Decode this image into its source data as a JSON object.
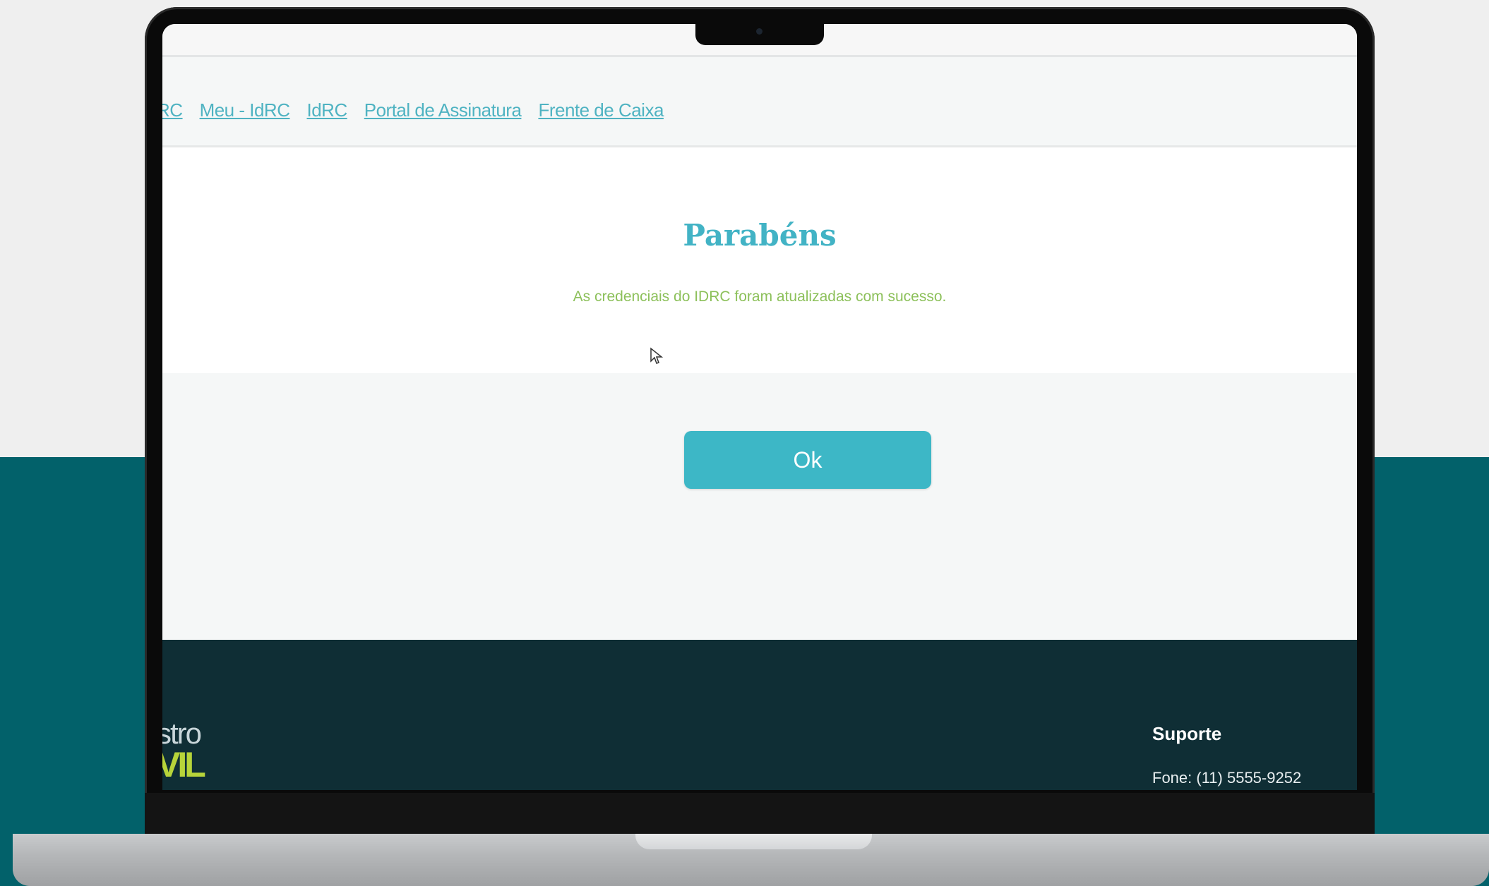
{
  "nav": {
    "links": [
      "RC",
      "Meu - IdRC",
      "IdRC",
      "Portal de Assinatura",
      "Frente de Caixa"
    ]
  },
  "dialog": {
    "title": "Parabéns",
    "message": "As credenciais do IDRC foram atualizadas com sucesso.",
    "ok_label": "Ok"
  },
  "footer": {
    "logo_top": "stro",
    "logo_bottom": "VIL",
    "support_title": "Suporte",
    "support_phone": "Fone: (11) 5555-9252"
  },
  "colors": {
    "accent": "#3db7c6",
    "title": "#42b3c5",
    "success": "#8cc05a",
    "footer_bg": "#0f2e35",
    "page_bg_bottom": "#02616a"
  }
}
